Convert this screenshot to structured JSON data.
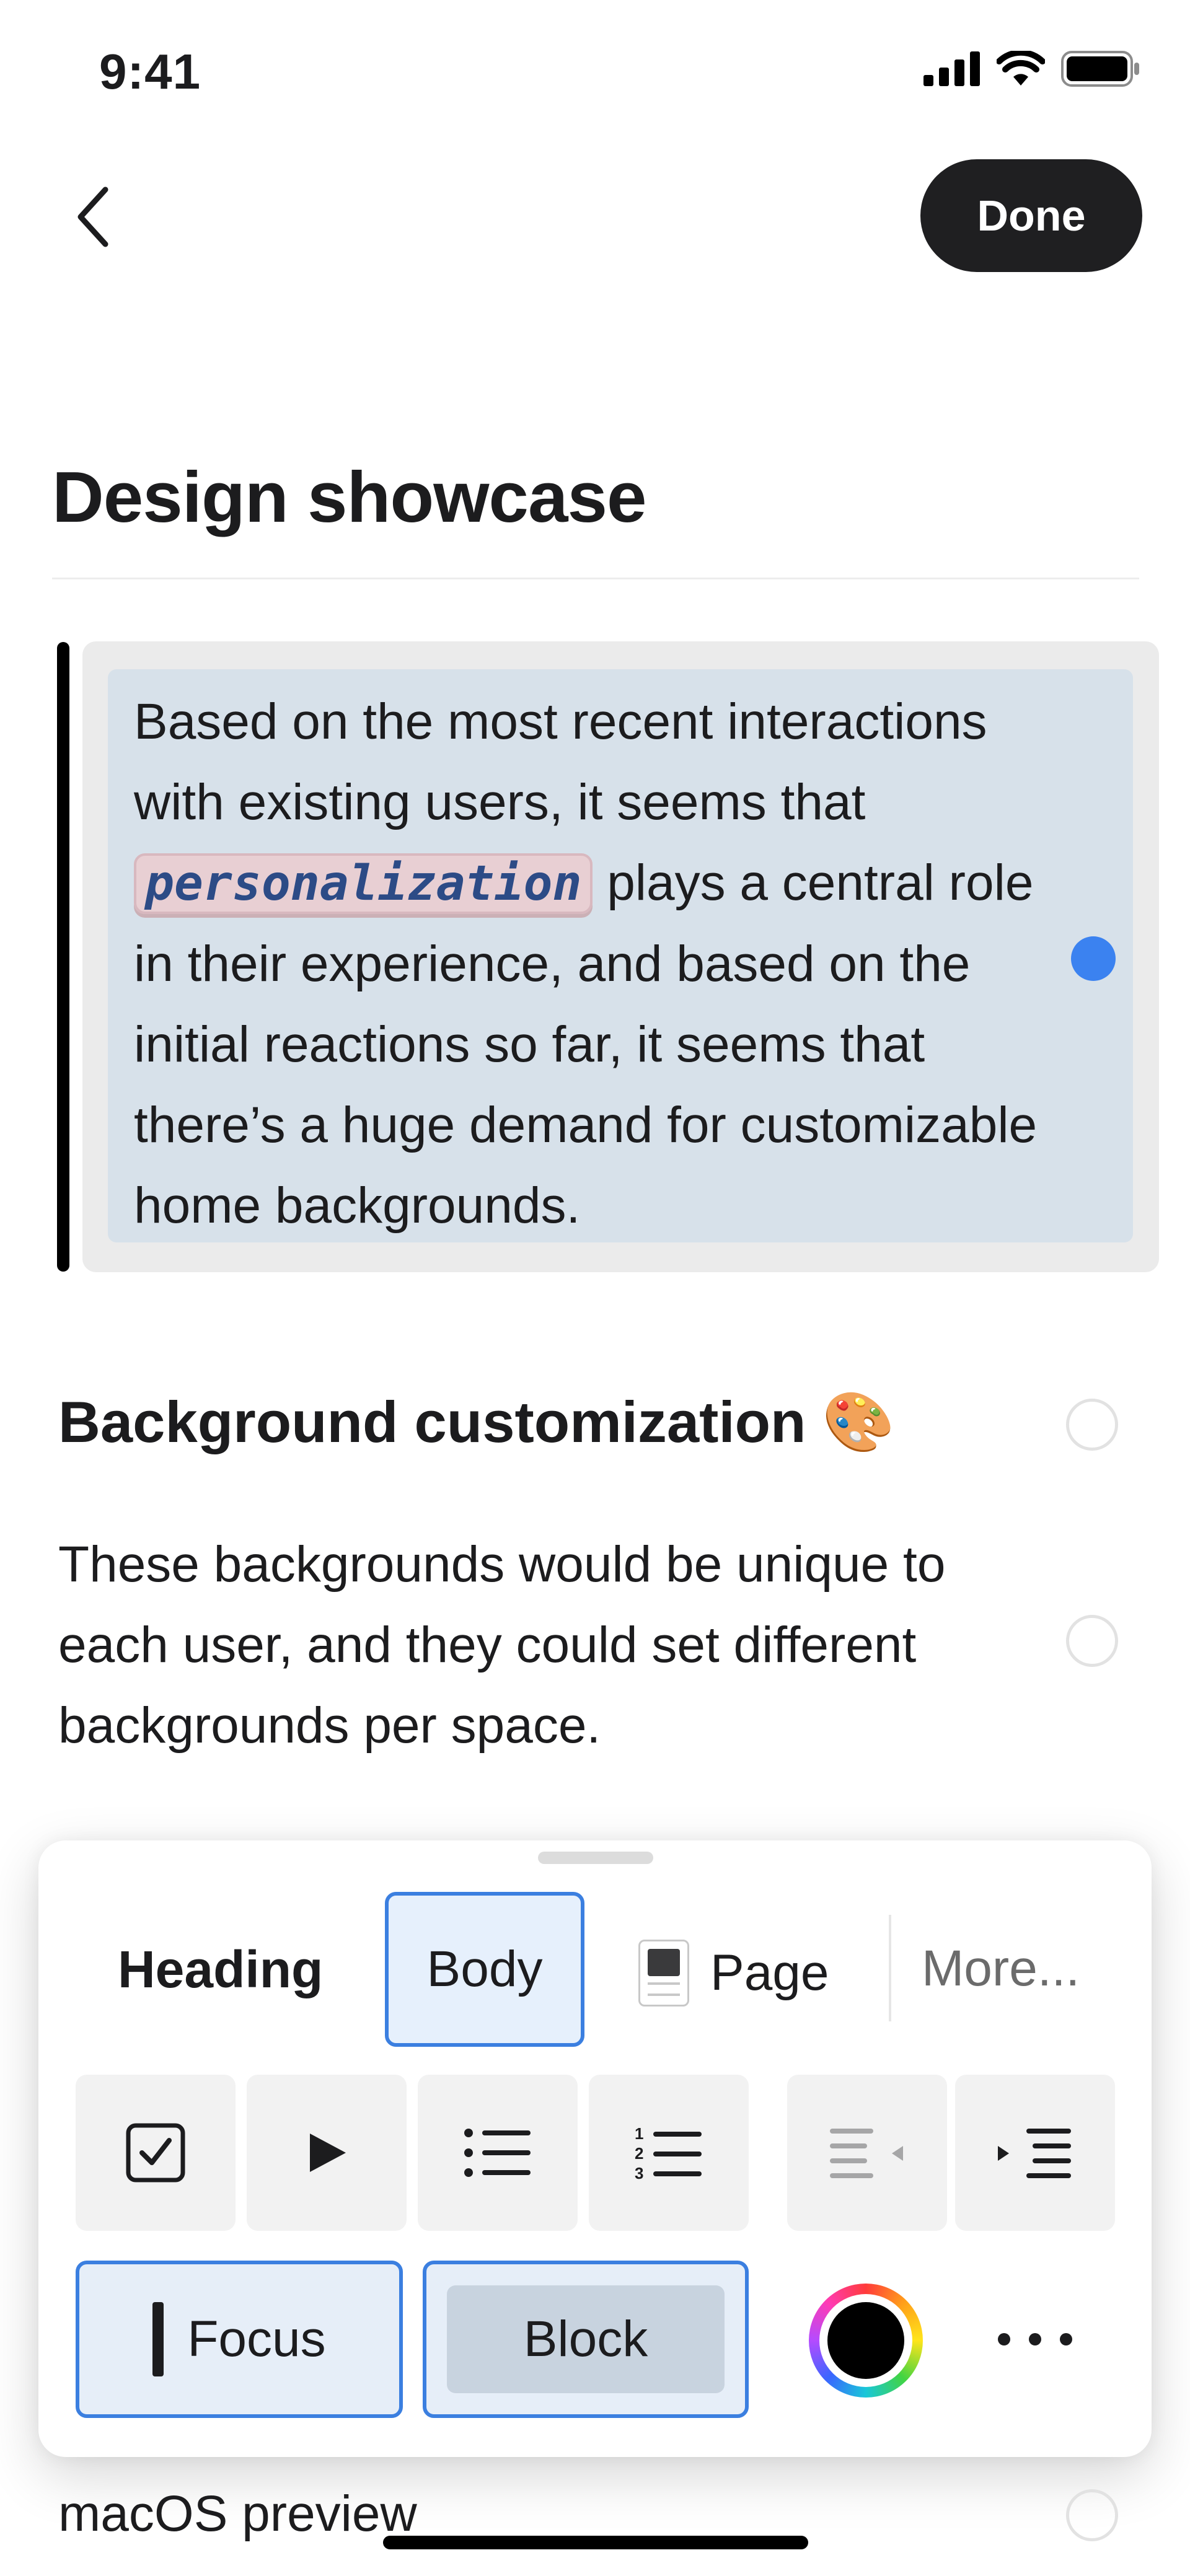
{
  "status_bar": {
    "time": "9:41",
    "icons": [
      "signal-icon",
      "wifi-icon",
      "battery-icon"
    ]
  },
  "nav": {
    "back_icon": "chevron-left-icon",
    "done_label": "Done"
  },
  "page": {
    "title": "Design showcase"
  },
  "focus_block": {
    "text_before": "Based on the most recent interactions with existing users, it seems that ",
    "mention": "personalization",
    "text_after": " plays a central role in their experience, and based on the initial reactions so far, it seems that there’s a huge demand for customizable home backgrounds."
  },
  "section": {
    "heading": "Background customization 🎨",
    "paragraph": "These backgrounds would be unique to each user, and they could set different backgrounds per space."
  },
  "sheet": {
    "styles": {
      "heading": "Heading",
      "body": "Body",
      "page": "Page",
      "more": "More..."
    },
    "tools": [
      "checkbox-icon",
      "toggle-play-icon",
      "bulleted-list-icon",
      "numbered-list-icon",
      "outdent-icon",
      "indent-icon"
    ],
    "focus_label": "Focus",
    "block_label": "Block",
    "color_icon": "color-wheel-icon",
    "more_icon": "ellipsis-icon"
  },
  "below_sheet": {
    "item_label": "macOS preview"
  },
  "colors": {
    "accent": "#3b7fe0",
    "dot": "#3b82f0",
    "done_bg": "#1f1f21",
    "block_bg": "#d7e1ea"
  }
}
